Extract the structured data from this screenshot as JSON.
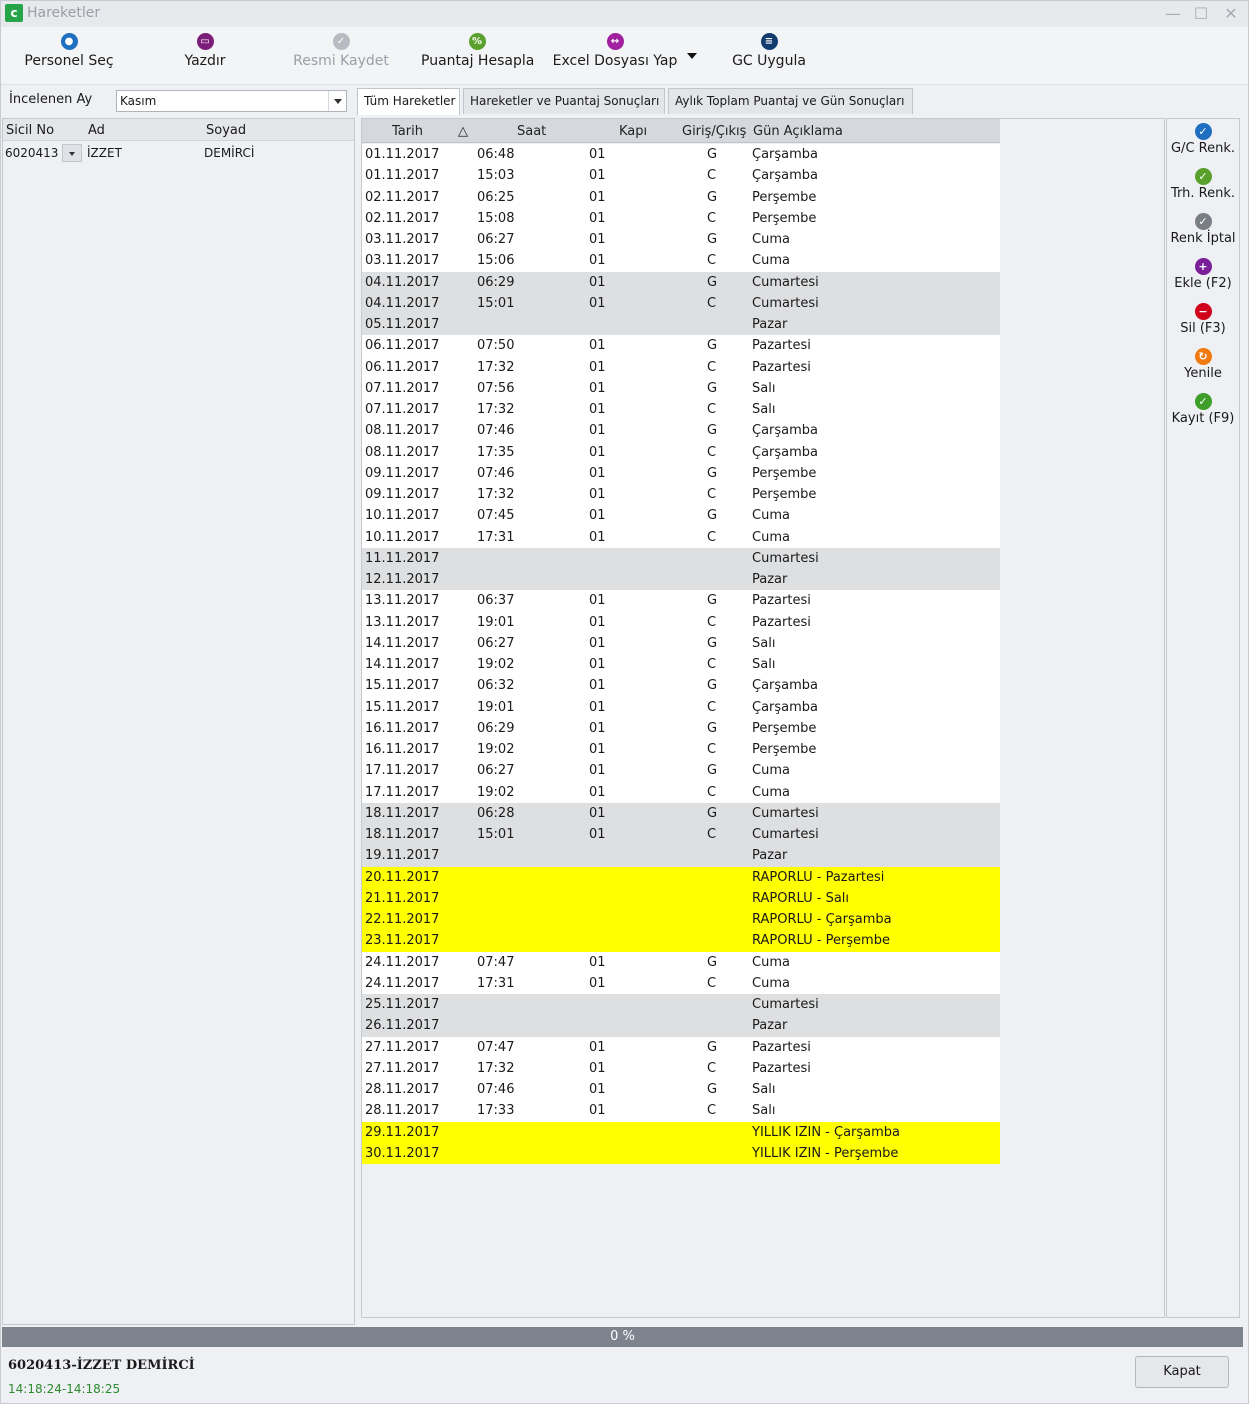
{
  "window": {
    "title": "Hareketler",
    "app_icon": "c"
  },
  "toolbar": {
    "buttons": [
      {
        "label": "Personel Seç",
        "icon": "person-icon",
        "color": "#1e6fbf",
        "disabled": false
      },
      {
        "label": "Yazdır",
        "icon": "printer-icon",
        "color": "#7b1e7a",
        "disabled": false
      },
      {
        "label": "Resmi Kaydet",
        "icon": "check-icon",
        "color": "#b8bcc2",
        "disabled": true
      },
      {
        "label": "Puantaj Hesapla",
        "icon": "calculator-icon",
        "color": "#5aa02c",
        "disabled": false
      },
      {
        "label": "Excel Dosyası Yap",
        "icon": "excel-export-icon",
        "color": "#a020a0",
        "disabled": false
      },
      {
        "label": "GC Uygula",
        "icon": "list-icon",
        "color": "#123c6e",
        "disabled": false
      }
    ]
  },
  "month": {
    "label": "İncelenen Ay",
    "value": "Kasım"
  },
  "left_grid": {
    "headers": [
      "Sicil No",
      "Ad",
      "Soyad"
    ],
    "rows": [
      {
        "sicil": "6020413",
        "ad": "İZZET",
        "soyad": "DEMİRCİ"
      }
    ]
  },
  "tabs": [
    "Tüm Hareketler",
    "Hareketler ve Puantaj Sonuçları",
    "Aylık Toplam Puantaj  ve Gün Sonuçları"
  ],
  "grid": {
    "headers": {
      "date": "Tarih",
      "time": "Saat",
      "door": "Kapı",
      "io": "Giriş/Çıkış",
      "desc": "Gün Açıklama"
    },
    "rows": [
      {
        "d": "01.11.2017",
        "t": "06:48",
        "k": "01",
        "g": "G",
        "a": "Çarşamba",
        "bg": "white"
      },
      {
        "d": "01.11.2017",
        "t": "15:03",
        "k": "01",
        "g": "C",
        "a": "Çarşamba",
        "bg": "white"
      },
      {
        "d": "02.11.2017",
        "t": "06:25",
        "k": "01",
        "g": "G",
        "a": "Perşembe",
        "bg": "white"
      },
      {
        "d": "02.11.2017",
        "t": "15:08",
        "k": "01",
        "g": "C",
        "a": "Perşembe",
        "bg": "white"
      },
      {
        "d": "03.11.2017",
        "t": "06:27",
        "k": "01",
        "g": "G",
        "a": "Cuma",
        "bg": "white"
      },
      {
        "d": "03.11.2017",
        "t": "15:06",
        "k": "01",
        "g": "C",
        "a": "Cuma",
        "bg": "white"
      },
      {
        "d": "04.11.2017",
        "t": "06:29",
        "k": "01",
        "g": "G",
        "a": "Cumartesi",
        "bg": "grey"
      },
      {
        "d": "04.11.2017",
        "t": "15:01",
        "k": "01",
        "g": "C",
        "a": "Cumartesi",
        "bg": "grey"
      },
      {
        "d": "05.11.2017",
        "t": "",
        "k": "",
        "g": "",
        "a": "Pazar",
        "bg": "grey"
      },
      {
        "d": "06.11.2017",
        "t": "07:50",
        "k": "01",
        "g": "G",
        "a": "Pazartesi",
        "bg": "white"
      },
      {
        "d": "06.11.2017",
        "t": "17:32",
        "k": "01",
        "g": "C",
        "a": "Pazartesi",
        "bg": "white"
      },
      {
        "d": "07.11.2017",
        "t": "07:56",
        "k": "01",
        "g": "G",
        "a": "Salı",
        "bg": "white"
      },
      {
        "d": "07.11.2017",
        "t": "17:32",
        "k": "01",
        "g": "C",
        "a": "Salı",
        "bg": "white"
      },
      {
        "d": "08.11.2017",
        "t": "07:46",
        "k": "01",
        "g": "G",
        "a": "Çarşamba",
        "bg": "white"
      },
      {
        "d": "08.11.2017",
        "t": "17:35",
        "k": "01",
        "g": "C",
        "a": "Çarşamba",
        "bg": "white"
      },
      {
        "d": "09.11.2017",
        "t": "07:46",
        "k": "01",
        "g": "G",
        "a": "Perşembe",
        "bg": "white"
      },
      {
        "d": "09.11.2017",
        "t": "17:32",
        "k": "01",
        "g": "C",
        "a": "Perşembe",
        "bg": "white"
      },
      {
        "d": "10.11.2017",
        "t": "07:45",
        "k": "01",
        "g": "G",
        "a": "Cuma",
        "bg": "white"
      },
      {
        "d": "10.11.2017",
        "t": "17:31",
        "k": "01",
        "g": "C",
        "a": "Cuma",
        "bg": "white"
      },
      {
        "d": "11.11.2017",
        "t": "",
        "k": "",
        "g": "",
        "a": "Cumartesi",
        "bg": "grey"
      },
      {
        "d": "12.11.2017",
        "t": "",
        "k": "",
        "g": "",
        "a": "Pazar",
        "bg": "grey"
      },
      {
        "d": "13.11.2017",
        "t": "06:37",
        "k": "01",
        "g": "G",
        "a": "Pazartesi",
        "bg": "white"
      },
      {
        "d": "13.11.2017",
        "t": "19:01",
        "k": "01",
        "g": "C",
        "a": "Pazartesi",
        "bg": "white"
      },
      {
        "d": "14.11.2017",
        "t": "06:27",
        "k": "01",
        "g": "G",
        "a": "Salı",
        "bg": "white"
      },
      {
        "d": "14.11.2017",
        "t": "19:02",
        "k": "01",
        "g": "C",
        "a": "Salı",
        "bg": "white"
      },
      {
        "d": "15.11.2017",
        "t": "06:32",
        "k": "01",
        "g": "G",
        "a": "Çarşamba",
        "bg": "white"
      },
      {
        "d": "15.11.2017",
        "t": "19:01",
        "k": "01",
        "g": "C",
        "a": "Çarşamba",
        "bg": "white"
      },
      {
        "d": "16.11.2017",
        "t": "06:29",
        "k": "01",
        "g": "G",
        "a": "Perşembe",
        "bg": "white"
      },
      {
        "d": "16.11.2017",
        "t": "19:02",
        "k": "01",
        "g": "C",
        "a": "Perşembe",
        "bg": "white"
      },
      {
        "d": "17.11.2017",
        "t": "06:27",
        "k": "01",
        "g": "G",
        "a": "Cuma",
        "bg": "white"
      },
      {
        "d": "17.11.2017",
        "t": "19:02",
        "k": "01",
        "g": "C",
        "a": "Cuma",
        "bg": "white"
      },
      {
        "d": "18.11.2017",
        "t": "06:28",
        "k": "01",
        "g": "G",
        "a": "Cumartesi",
        "bg": "grey"
      },
      {
        "d": "18.11.2017",
        "t": "15:01",
        "k": "01",
        "g": "C",
        "a": "Cumartesi",
        "bg": "grey"
      },
      {
        "d": "19.11.2017",
        "t": "",
        "k": "",
        "g": "",
        "a": "Pazar",
        "bg": "grey"
      },
      {
        "d": "20.11.2017",
        "t": "",
        "k": "",
        "g": "",
        "a": "RAPORLU - Pazartesi",
        "bg": "yellow"
      },
      {
        "d": "21.11.2017",
        "t": "",
        "k": "",
        "g": "",
        "a": "RAPORLU - Salı",
        "bg": "yellow"
      },
      {
        "d": "22.11.2017",
        "t": "",
        "k": "",
        "g": "",
        "a": "RAPORLU - Çarşamba",
        "bg": "yellow"
      },
      {
        "d": "23.11.2017",
        "t": "",
        "k": "",
        "g": "",
        "a": "RAPORLU - Perşembe",
        "bg": "yellow"
      },
      {
        "d": "24.11.2017",
        "t": "07:47",
        "k": "01",
        "g": "G",
        "a": "Cuma",
        "bg": "white"
      },
      {
        "d": "24.11.2017",
        "t": "17:31",
        "k": "01",
        "g": "C",
        "a": "Cuma",
        "bg": "white"
      },
      {
        "d": "25.11.2017",
        "t": "",
        "k": "",
        "g": "",
        "a": "Cumartesi",
        "bg": "grey"
      },
      {
        "d": "26.11.2017",
        "t": "",
        "k": "",
        "g": "",
        "a": "Pazar",
        "bg": "grey"
      },
      {
        "d": "27.11.2017",
        "t": "07:47",
        "k": "01",
        "g": "G",
        "a": "Pazartesi",
        "bg": "white"
      },
      {
        "d": "27.11.2017",
        "t": "17:32",
        "k": "01",
        "g": "C",
        "a": "Pazartesi",
        "bg": "white"
      },
      {
        "d": "28.11.2017",
        "t": "07:46",
        "k": "01",
        "g": "G",
        "a": "Salı",
        "bg": "white"
      },
      {
        "d": "28.11.2017",
        "t": "17:33",
        "k": "01",
        "g": "C",
        "a": "Salı",
        "bg": "white"
      },
      {
        "d": "29.11.2017",
        "t": "",
        "k": "",
        "g": "",
        "a": "YILLIK IZIN - Çarşamba",
        "bg": "yellow"
      },
      {
        "d": "30.11.2017",
        "t": "",
        "k": "",
        "g": "",
        "a": "YILLIK IZIN - Perşembe",
        "bg": "yellow"
      }
    ]
  },
  "side_buttons": [
    {
      "label": "G/C Renk.",
      "icon": "gc-color-icon",
      "color": "#1e6fbf"
    },
    {
      "label": "Trh. Renk.",
      "icon": "date-color-icon",
      "color": "#5aa02c"
    },
    {
      "label": "Renk İptal",
      "icon": "color-cancel-icon",
      "color": "#7a7f86"
    },
    {
      "label": "Ekle (F2)",
      "icon": "add-icon",
      "color": "#7b1e9a"
    },
    {
      "label": "Sil (F3)",
      "icon": "delete-icon",
      "color": "#d0021b"
    },
    {
      "label": "Yenile",
      "icon": "refresh-icon",
      "color": "#f07a10"
    },
    {
      "label": "Kayıt (F9)",
      "icon": "save-check-icon",
      "color": "#3f9e2a"
    }
  ],
  "progress": {
    "text": "0 %",
    "value": 0
  },
  "status": {
    "name": "6020413-İZZET DEMİRCİ",
    "time": "14:18:24-14:18:25"
  },
  "close_button": "Kapat",
  "colors": {
    "row_white": "#ffffff",
    "row_grey": "#dedfe1",
    "row_yellow": "#ffff00",
    "status_time": "#2d8a2f"
  }
}
